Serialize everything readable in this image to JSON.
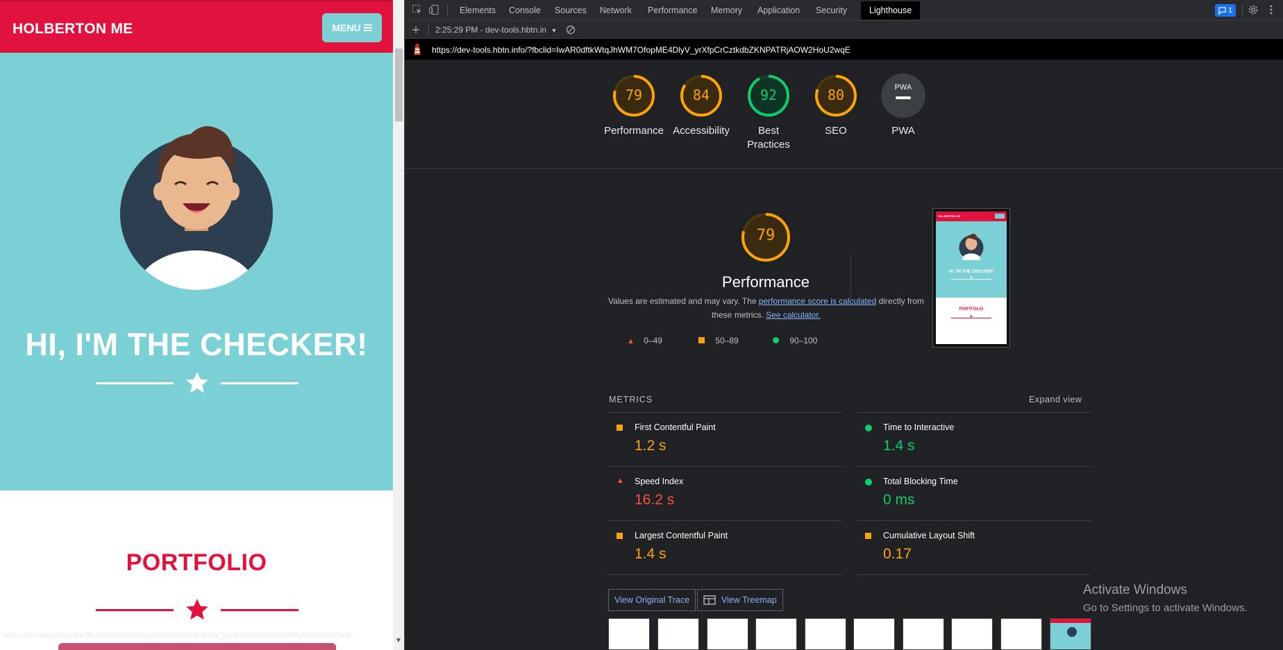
{
  "site": {
    "logo": "HOLBERTON ME",
    "menu_label": "MENU",
    "hero_title": "HI, I'M THE CHECKER!",
    "section_title": "PORTFOLIO",
    "status_url": "https://dev-tools.hbtn.info/?fbclid=IwAR0dftkWtqJhWM7OfopME4DlyV_yrXfpCrCztkdbZKNPATRjAOW2HoU2wqE",
    "colors": {
      "brand_red": "#e2123f",
      "teal": "#7ad0d4"
    }
  },
  "devtools": {
    "tabs": [
      "Elements",
      "Console",
      "Sources",
      "Network",
      "Performance",
      "Memory",
      "Application",
      "Security",
      "Lighthouse"
    ],
    "active_tab": "Lighthouse",
    "issues_count": "1",
    "report_select": "2:25:29 PM - dev-tools.hbtn.in",
    "url": "https://dev-tools.hbtn.info/?fbclid=IwAR0dftkWtqJhWM7OfopME4DlyV_yrXfpCrCztkdbZKNPATRjAOW2HoU2wqE",
    "gauges": [
      {
        "score": "79",
        "label": "Performance",
        "color": "#ffa400"
      },
      {
        "score": "84",
        "label": "Accessibility",
        "color": "#ffa400"
      },
      {
        "score": "92",
        "label": "Best Practices",
        "color": "#0cce6b"
      },
      {
        "score": "80",
        "label": "SEO",
        "color": "#ffa400"
      },
      {
        "score": "",
        "label": "PWA",
        "color": "#9aa0a6"
      }
    ],
    "perf": {
      "score": "79",
      "title": "Performance",
      "desc_pre": "Values are estimated and may vary. The ",
      "desc_link1": "performance score is calculated",
      "desc_mid": " directly from these metrics. ",
      "desc_link2": "See calculator."
    },
    "legend": {
      "fail": "0–49",
      "average": "50–89",
      "pass": "90–100"
    },
    "thumb": {
      "logo": "HOLBERTON ME",
      "title": "HI, I'M THE CHECKER!",
      "section": "PORTFOLIO"
    },
    "metrics_title": "METRICS",
    "expand_view": "Expand view",
    "metrics": [
      {
        "name": "First Contentful Paint",
        "value": "1.2 s",
        "status": "average"
      },
      {
        "name": "Time to Interactive",
        "value": "1.4 s",
        "status": "pass"
      },
      {
        "name": "Speed Index",
        "value": "16.2 s",
        "status": "fail"
      },
      {
        "name": "Total Blocking Time",
        "value": "0 ms",
        "status": "pass"
      },
      {
        "name": "Largest Contentful Paint",
        "value": "1.4 s",
        "status": "average"
      },
      {
        "name": "Cumulative Layout Shift",
        "value": "0.17",
        "status": "average"
      }
    ],
    "buttons": {
      "trace": "View Original Trace",
      "treemap": "View Treemap"
    }
  },
  "windows": {
    "title": "Activate Windows",
    "subtitle": "Go to Settings to activate Windows."
  }
}
